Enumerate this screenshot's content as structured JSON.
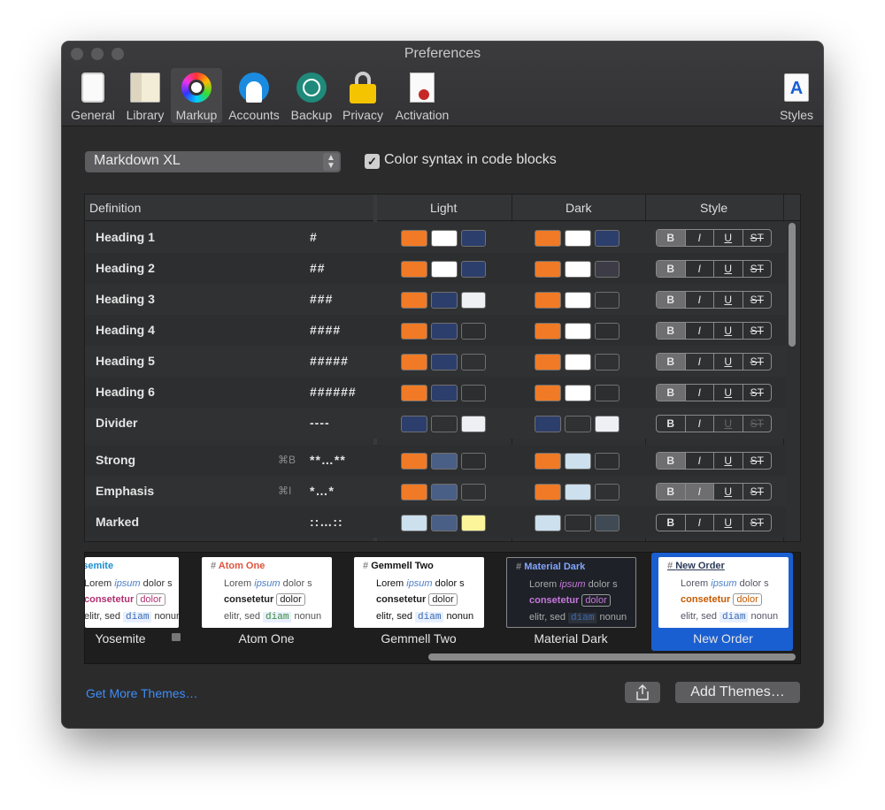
{
  "window": {
    "title": "Preferences"
  },
  "toolbar": [
    {
      "label": "General",
      "icon": "general-icon"
    },
    {
      "label": "Library",
      "icon": "library-icon"
    },
    {
      "label": "Markup",
      "icon": "markup-icon"
    },
    {
      "label": "Accounts",
      "icon": "accounts-icon"
    },
    {
      "label": "Backup",
      "icon": "backup-icon"
    },
    {
      "label": "Privacy",
      "icon": "privacy-icon"
    },
    {
      "label": "Activation",
      "icon": "activation-icon"
    },
    {
      "label": "Styles",
      "icon": "styles-icon"
    }
  ],
  "markup_select": {
    "value": "Markdown XL"
  },
  "color_syntax": {
    "label": "Color syntax in code blocks",
    "checked": true
  },
  "table": {
    "headers": [
      "Definition",
      "Light",
      "Dark",
      "Style"
    ],
    "style_buttons": [
      "B",
      "I",
      "U",
      "ST"
    ],
    "rows": [
      {
        "name": "Heading 1",
        "markup": "#",
        "shortcut": ""
      },
      {
        "name": "Heading 2",
        "markup": "##",
        "shortcut": ""
      },
      {
        "name": "Heading 3",
        "markup": "###",
        "shortcut": ""
      },
      {
        "name": "Heading 4",
        "markup": "####",
        "shortcut": ""
      },
      {
        "name": "Heading 5",
        "markup": "#####",
        "shortcut": ""
      },
      {
        "name": "Heading 6",
        "markup": "######",
        "shortcut": ""
      },
      {
        "name": "Divider",
        "markup": "----",
        "shortcut": ""
      },
      {
        "name": "Strong",
        "markup": "**…**",
        "shortcut": "⌘B"
      },
      {
        "name": "Emphasis",
        "markup": "*…*",
        "shortcut": "⌘I"
      },
      {
        "name": "Marked",
        "markup": "::…::",
        "shortcut": ""
      }
    ]
  },
  "themes": [
    {
      "name": "Yosemite",
      "title": "Yosemite",
      "locked": true
    },
    {
      "name": "Atom One",
      "title": "Atom One"
    },
    {
      "name": "Gemmell Two",
      "title": "Gemmell Two"
    },
    {
      "name": "Material Dark",
      "title": "Material Dark"
    },
    {
      "name": "New Order",
      "title": "New Order",
      "selected": true
    }
  ],
  "preview_text": {
    "line1a": "Lorem ",
    "line1b": "ipsum",
    "line1c": " dolor s",
    "line2": "consetetur",
    "line2b": "dolor",
    "line3a": "elitr, sed ",
    "line3b": "diam",
    "line3c": " nonun"
  },
  "footer": {
    "get_more": "Get More Themes…",
    "add_themes": "Add Themes…",
    "share_icon": "share-icon"
  },
  "colors": {
    "orange": "#f07a25",
    "white": "#ffffff",
    "navy": "#2c3e6b",
    "blue_gray": "#4a5f85",
    "light_blue": "#cce0ee",
    "yellow": "#fdf59a",
    "accent": "#1a5fd1"
  }
}
